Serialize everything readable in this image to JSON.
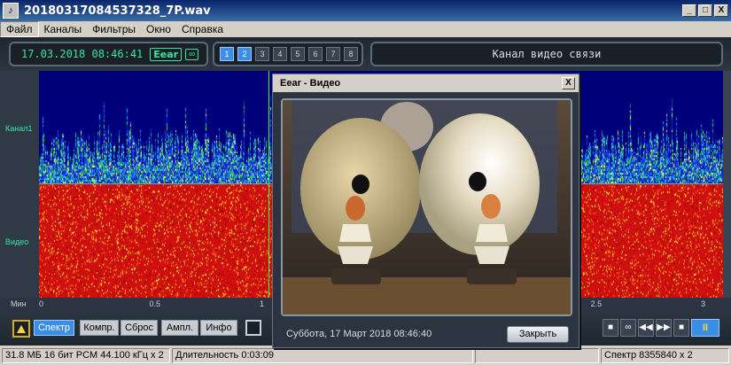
{
  "window": {
    "title": "20180317084537328_7P.wav",
    "min": "_",
    "max": "□",
    "close": "X"
  },
  "menu": [
    "Файл",
    "Каналы",
    "Фильтры",
    "Окно",
    "Справка"
  ],
  "toolbar": {
    "datetime": "17.03.2018 08:46:41",
    "eear": "Eear",
    "loop": "∞",
    "channels": [
      "1",
      "2",
      "3",
      "4",
      "5",
      "6",
      "7",
      "8"
    ],
    "active_channels": [
      1,
      2
    ],
    "channel_name": "Канал видео связи"
  },
  "tracks": {
    "track1_label": "Канал1",
    "track2_label": "Видео"
  },
  "ruler": {
    "unit": "Мин",
    "ticks": [
      {
        "label": "0",
        "pos": 0
      },
      {
        "label": "0.5",
        "pos": 0.5
      },
      {
        "label": "1",
        "pos": 1
      },
      {
        "label": "2.5",
        "pos": 2.5
      },
      {
        "label": "3",
        "pos": 3
      }
    ],
    "range": [
      0,
      3.1
    ]
  },
  "controls": {
    "spectr": "Спектр",
    "kompr": "Компр.",
    "sbros": "Сброс",
    "ampl": "Ампл.",
    "info": "Инфо",
    "pause": "II"
  },
  "status": {
    "file": "31.8 МБ 16 бит PCM 44.100 кГц x 2",
    "duration": "Длительность 0:03:09",
    "spectrum": "Спектр 8355840 x 2"
  },
  "dialog": {
    "title": "Eear - Видео",
    "close_x": "X",
    "date": "Суббота, 17 Март 2018 08:46:40",
    "close_button": "Закрыть"
  }
}
